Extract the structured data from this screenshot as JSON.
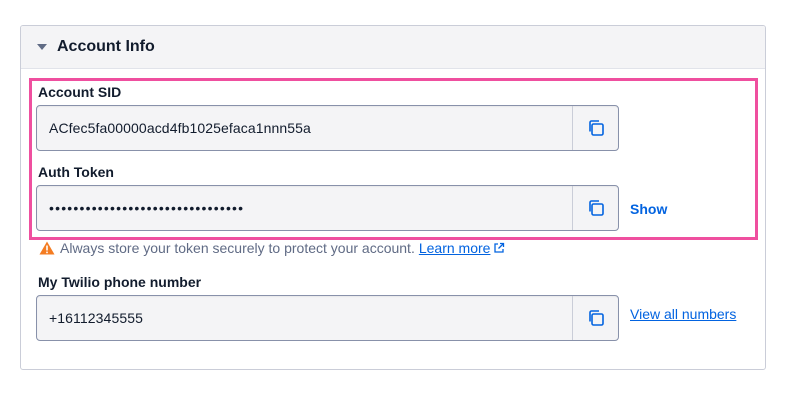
{
  "section": {
    "title": "Account Info"
  },
  "account_sid": {
    "label": "Account SID",
    "value": "ACfec5fa00000acd4fb1025efaca1nnn55a"
  },
  "auth_token": {
    "label": "Auth Token",
    "value": "••••••••••••••••••••••••••••••••",
    "show_label": "Show"
  },
  "warning": {
    "text": "Always store your token securely to protect your account.",
    "link_label": "Learn more"
  },
  "phone": {
    "label": "My Twilio phone number",
    "value": "+16112345555",
    "link_label": "View all numbers"
  },
  "colors": {
    "highlight": "#ef4f9f",
    "link": "#0263e0",
    "warning": "#f47c22"
  },
  "icons": [
    "caret-down-icon",
    "copy-icon",
    "warning-icon",
    "external-link-icon"
  ]
}
